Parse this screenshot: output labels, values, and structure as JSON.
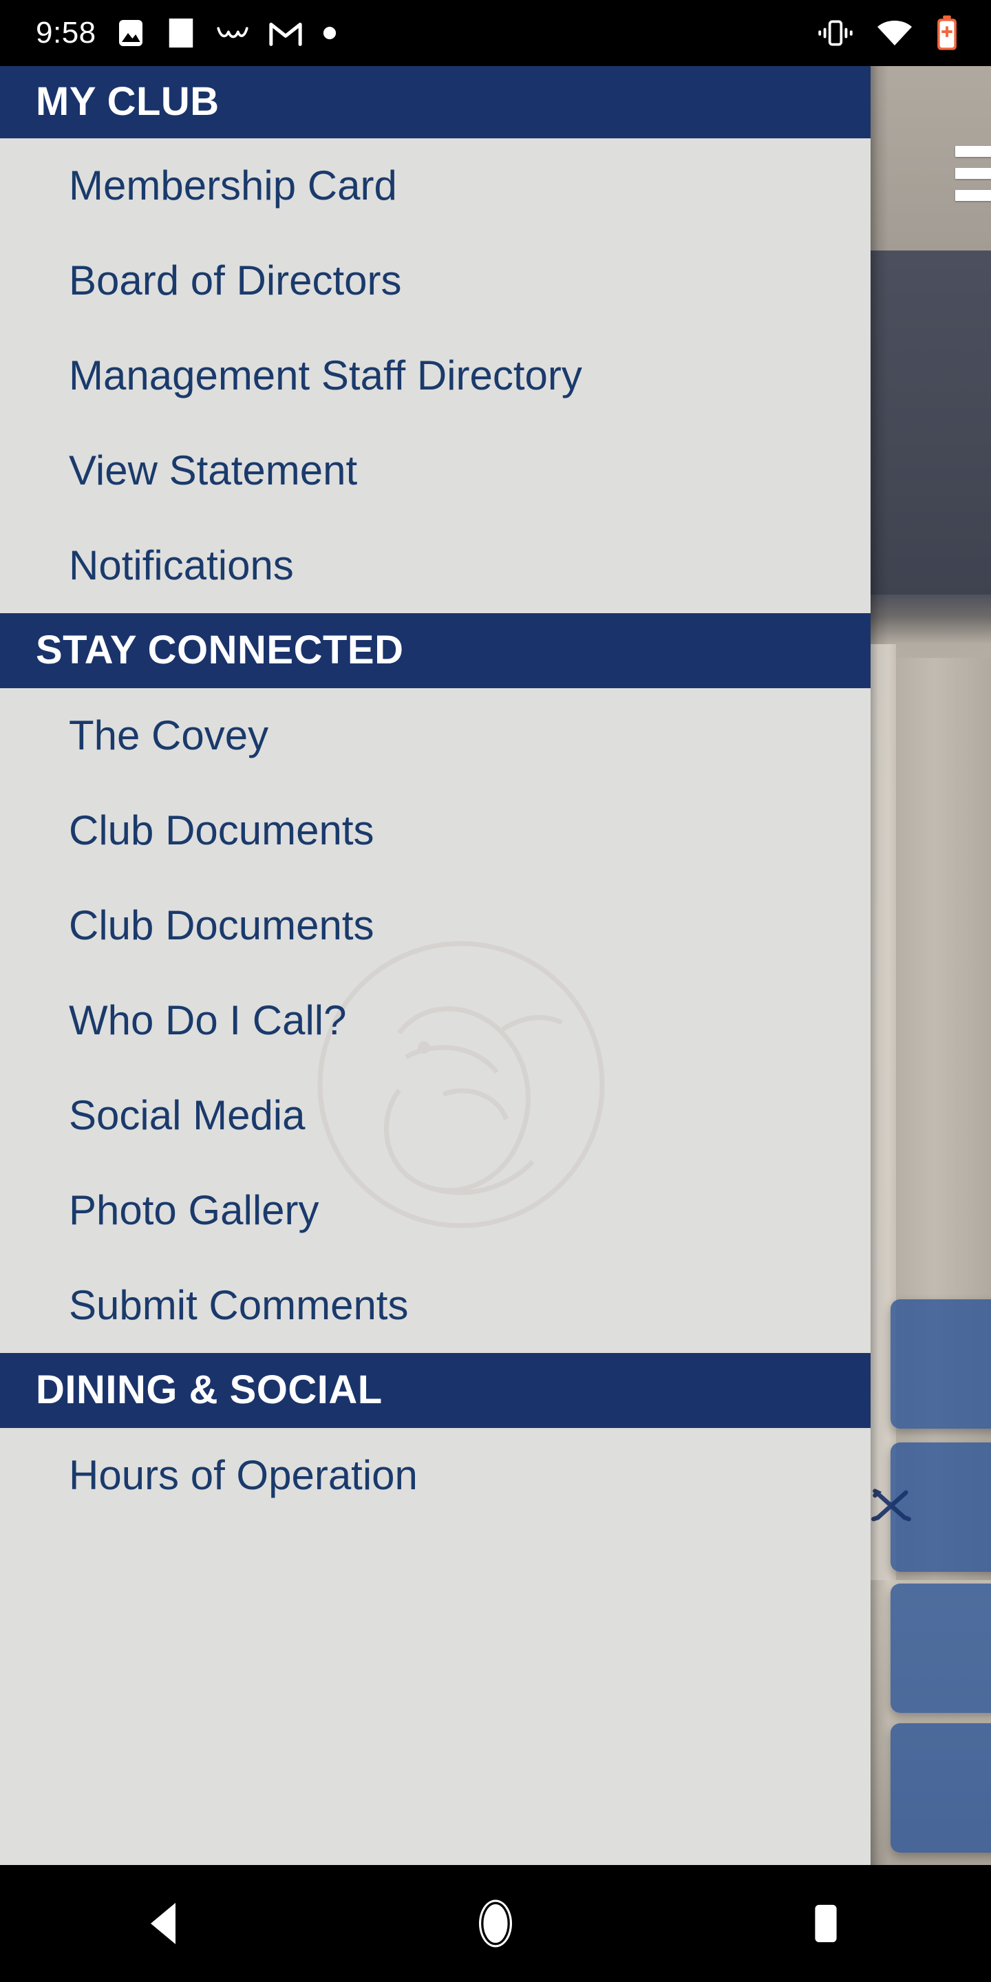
{
  "status_bar": {
    "time": "9:58",
    "left_icons": [
      {
        "name": "photos-icon",
        "label": "image"
      },
      {
        "name": "blank-notification-icon",
        "label": "notification"
      },
      {
        "name": "wellness-icon",
        "label": "wellness"
      },
      {
        "name": "gmail-icon",
        "label": "Gmail"
      },
      {
        "name": "more-notifications-dot-icon",
        "label": "more"
      }
    ],
    "right_icons": [
      {
        "name": "vibrate-mode-icon",
        "label": "Vibrate"
      },
      {
        "name": "wifi-icon",
        "label": "Wi-Fi"
      },
      {
        "name": "battery-saver-icon",
        "label": "Battery saver"
      }
    ]
  },
  "colors": {
    "navy": "#1a336b",
    "drawer_bg": "#dededd",
    "menu_text": "#1a3a6b",
    "header_text": "#ffffff",
    "tile_blue": "#2e5696",
    "nav_bar_bg": "#000000",
    "status_bar_bg": "#000000",
    "battery_accent": "#f2663c"
  },
  "drawer": {
    "sections": [
      {
        "title": "MY CLUB",
        "items": [
          {
            "label": "Membership Card"
          },
          {
            "label": "Board of Directors"
          },
          {
            "label": "Management Staff Directory"
          },
          {
            "label": "View Statement"
          },
          {
            "label": "Notifications"
          }
        ]
      },
      {
        "title": "STAY CONNECTED",
        "items": [
          {
            "label": "The Covey"
          },
          {
            "label": "Club Documents"
          },
          {
            "label": "Club Documents"
          },
          {
            "label": "Who Do I Call?"
          },
          {
            "label": "Social Media"
          },
          {
            "label": "Photo Gallery"
          },
          {
            "label": "Submit Comments"
          }
        ]
      },
      {
        "title": "DINING & SOCIAL",
        "items": [
          {
            "label": "Hours of Operation"
          }
        ]
      }
    ],
    "watermark": {
      "name": "club-quail-logo-watermark"
    }
  },
  "background_page": {
    "menu_button": {
      "name": "hamburger-menu-icon",
      "label": "Menu"
    },
    "tiles": [
      {
        "name": "home-tile-1"
      },
      {
        "name": "home-tile-2"
      },
      {
        "name": "home-tile-3"
      },
      {
        "name": "home-tile-4"
      }
    ]
  },
  "nav_bar": {
    "buttons": [
      {
        "name": "back-button",
        "label": "Back"
      },
      {
        "name": "home-button",
        "label": "Home"
      },
      {
        "name": "recents-button",
        "label": "Recent apps"
      }
    ]
  }
}
